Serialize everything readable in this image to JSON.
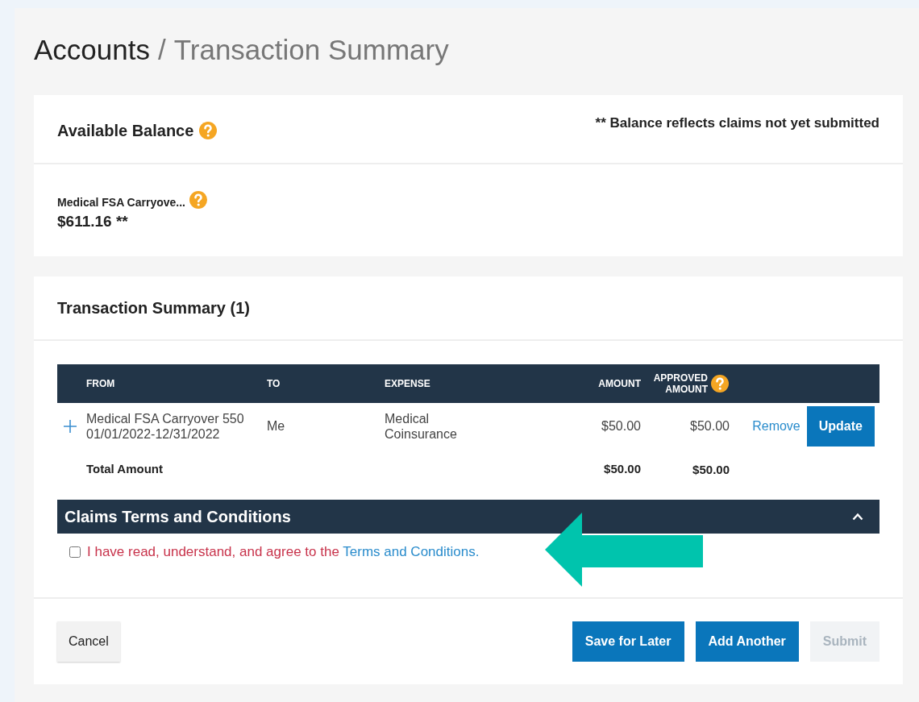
{
  "breadcrumb": {
    "parent": "Accounts",
    "separator": "/",
    "current": "Transaction Summary"
  },
  "balance_card": {
    "title": "Available Balance",
    "note": "** Balance reflects claims not yet submitted",
    "account_name": "Medical FSA Carryove...",
    "amount": "$611.16 **"
  },
  "summary_card": {
    "title": "Transaction Summary (1)",
    "table": {
      "columns": [
        "FROM",
        "TO",
        "EXPENSE",
        "AMOUNT",
        "APPROVED AMOUNT"
      ],
      "rows": [
        {
          "expanded": false,
          "from": [
            "Medical FSA Carryover 550",
            "01/01/2022-12/31/2022"
          ],
          "to": "Me",
          "expense": [
            "Medical",
            "Coinsurance"
          ],
          "amount": "$50.00",
          "approved_amount": "$50.00",
          "actions": [
            {
              "kind": "link",
              "label": "Remove"
            },
            {
              "kind": "primary",
              "label": "Update"
            }
          ]
        }
      ],
      "total": {
        "label": "Total Amount",
        "amount": "$50.00",
        "approved_amount": "$50.00"
      }
    },
    "terms": {
      "title": "Claims Terms and Conditions",
      "expanded": true,
      "checked": false,
      "text": "I have read, understand, and agree to the ",
      "link": "Terms and Conditions."
    },
    "buttons": [
      {
        "kind": "secondary",
        "label": "Cancel",
        "disabled": false
      },
      {
        "kind": "primary",
        "label": "Save for Later",
        "disabled": false
      },
      {
        "kind": "primary",
        "label": "Add Another",
        "disabled": false
      },
      {
        "kind": "primary",
        "label": "Submit",
        "disabled": true
      }
    ]
  }
}
